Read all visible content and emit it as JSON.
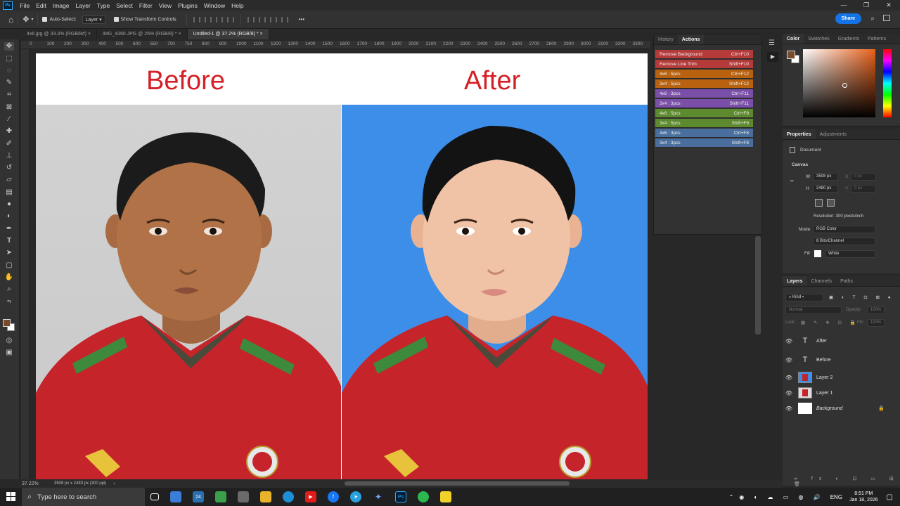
{
  "app": {
    "logo": "Ps"
  },
  "menu": [
    "File",
    "Edit",
    "Image",
    "Layer",
    "Type",
    "Select",
    "Filter",
    "View",
    "Plugins",
    "Window",
    "Help"
  ],
  "window_controls": {
    "minimize": "—",
    "restore": "❐",
    "close": "✕"
  },
  "options_bar": {
    "auto_select_label": "Auto-Select:",
    "auto_select_value": "Layer",
    "show_transform_label": "Show Transform Controls",
    "more": "•••",
    "share_label": "Share"
  },
  "tabs": [
    {
      "label": "4x6.jpg @ 33.3% (RGB/8#)",
      "close": "×"
    },
    {
      "label": "IMG_4390.JPG @ 25% (RGB/8) *",
      "close": "×"
    },
    {
      "label": "Untitled-1 @ 37.2% (RGB/8) *",
      "close": "×"
    }
  ],
  "ruler_labels": [
    "0",
    "100",
    "200",
    "300",
    "400",
    "500",
    "600",
    "650",
    "700",
    "750",
    "800",
    "900",
    "1000",
    "1100",
    "1200",
    "1300",
    "1400",
    "1500",
    "1600",
    "1700",
    "1800",
    "1900",
    "2000",
    "2100",
    "2200",
    "2300",
    "2400",
    "2500",
    "2600",
    "2700",
    "2800",
    "2900",
    "3000",
    "3100",
    "3200",
    "3300"
  ],
  "canvas": {
    "before_label": "Before",
    "after_label": "After",
    "before_bg": "#d9d9d9",
    "after_bg": "#3c8ee8",
    "title_color": "#d51f26"
  },
  "history_panel": {
    "tabs": [
      "History",
      "Actions"
    ],
    "active_tab": "Actions",
    "actions": [
      {
        "name": "Remove Background",
        "shortcut": "Ctrl+F10",
        "color": "#b53b3b"
      },
      {
        "name": "Remove Line Trim",
        "shortcut": "Shift+F10",
        "color": "#b53b3b"
      },
      {
        "name": "4x6 : 5pcs",
        "shortcut": "Ctrl+F12",
        "color": "#b8620f"
      },
      {
        "name": "3x4 : 5pcs",
        "shortcut": "Shift+F12",
        "color": "#b8620f"
      },
      {
        "name": "4x6 : 3pcs",
        "shortcut": "Ctrl+F11",
        "color": "#7a4fa8"
      },
      {
        "name": "3x4 : 3pcs",
        "shortcut": "Shift+F11",
        "color": "#7a4fa8"
      },
      {
        "name": "4x6 : 5pcs",
        "shortcut": "Ctrl+F9",
        "color": "#5d8a2e"
      },
      {
        "name": "3x4 : 5pcs",
        "shortcut": "Shift+F9",
        "color": "#5d8a2e"
      },
      {
        "name": "4x6 : 3pcs",
        "shortcut": "Ctrl+F8",
        "color": "#4a6f9e"
      },
      {
        "name": "3x4 : 3pcs",
        "shortcut": "Shift+F8",
        "color": "#4a6f9e"
      }
    ]
  },
  "color_panel": {
    "tabs": [
      "Color",
      "Swatches",
      "Gradients",
      "Patterns"
    ],
    "foreground": "#7a4a2c",
    "background": "#ffffff",
    "hue_color": "#e8601a"
  },
  "properties": {
    "tabs": [
      "Properties",
      "Adjustments"
    ],
    "section": "Document",
    "canvas_label": "Canvas",
    "w_label": "W",
    "w_value": "3508 px",
    "h_label": "H",
    "h_value": "2480 px",
    "x_label": "X",
    "x_value": "0 px",
    "y_label": "Y",
    "y_value": "0 px",
    "resolution": "Resolution: 300 pixels/inch",
    "mode_label": "Mode",
    "mode_value": "RGB Color",
    "bits_value": "8 Bits/Channel",
    "fill_label": "Fill",
    "fill_value": "White"
  },
  "layers_panel": {
    "tabs": [
      "Layers",
      "Channels",
      "Paths"
    ],
    "filter": "Kind",
    "blend": "Normal",
    "opacity_label": "Opacity:",
    "opacity_value": "100%",
    "lock_label": "Lock:",
    "fill_label": "Fill:",
    "fill_value": "100%",
    "layers": [
      {
        "name": "After",
        "type": "text"
      },
      {
        "name": "Before",
        "type": "text"
      },
      {
        "name": "Layer 2",
        "type": "image"
      },
      {
        "name": "Layer 1",
        "type": "image"
      },
      {
        "name": "Background",
        "type": "background"
      }
    ]
  },
  "status": {
    "zoom": "37.22%",
    "doc_size": "3508 px x 2480 px (300 ppi)"
  },
  "taskbar": {
    "search_placeholder": "Type here to search",
    "weather": "24",
    "language": "ENG",
    "time": "8:51 PM",
    "date": "Jan 18, 2026"
  }
}
